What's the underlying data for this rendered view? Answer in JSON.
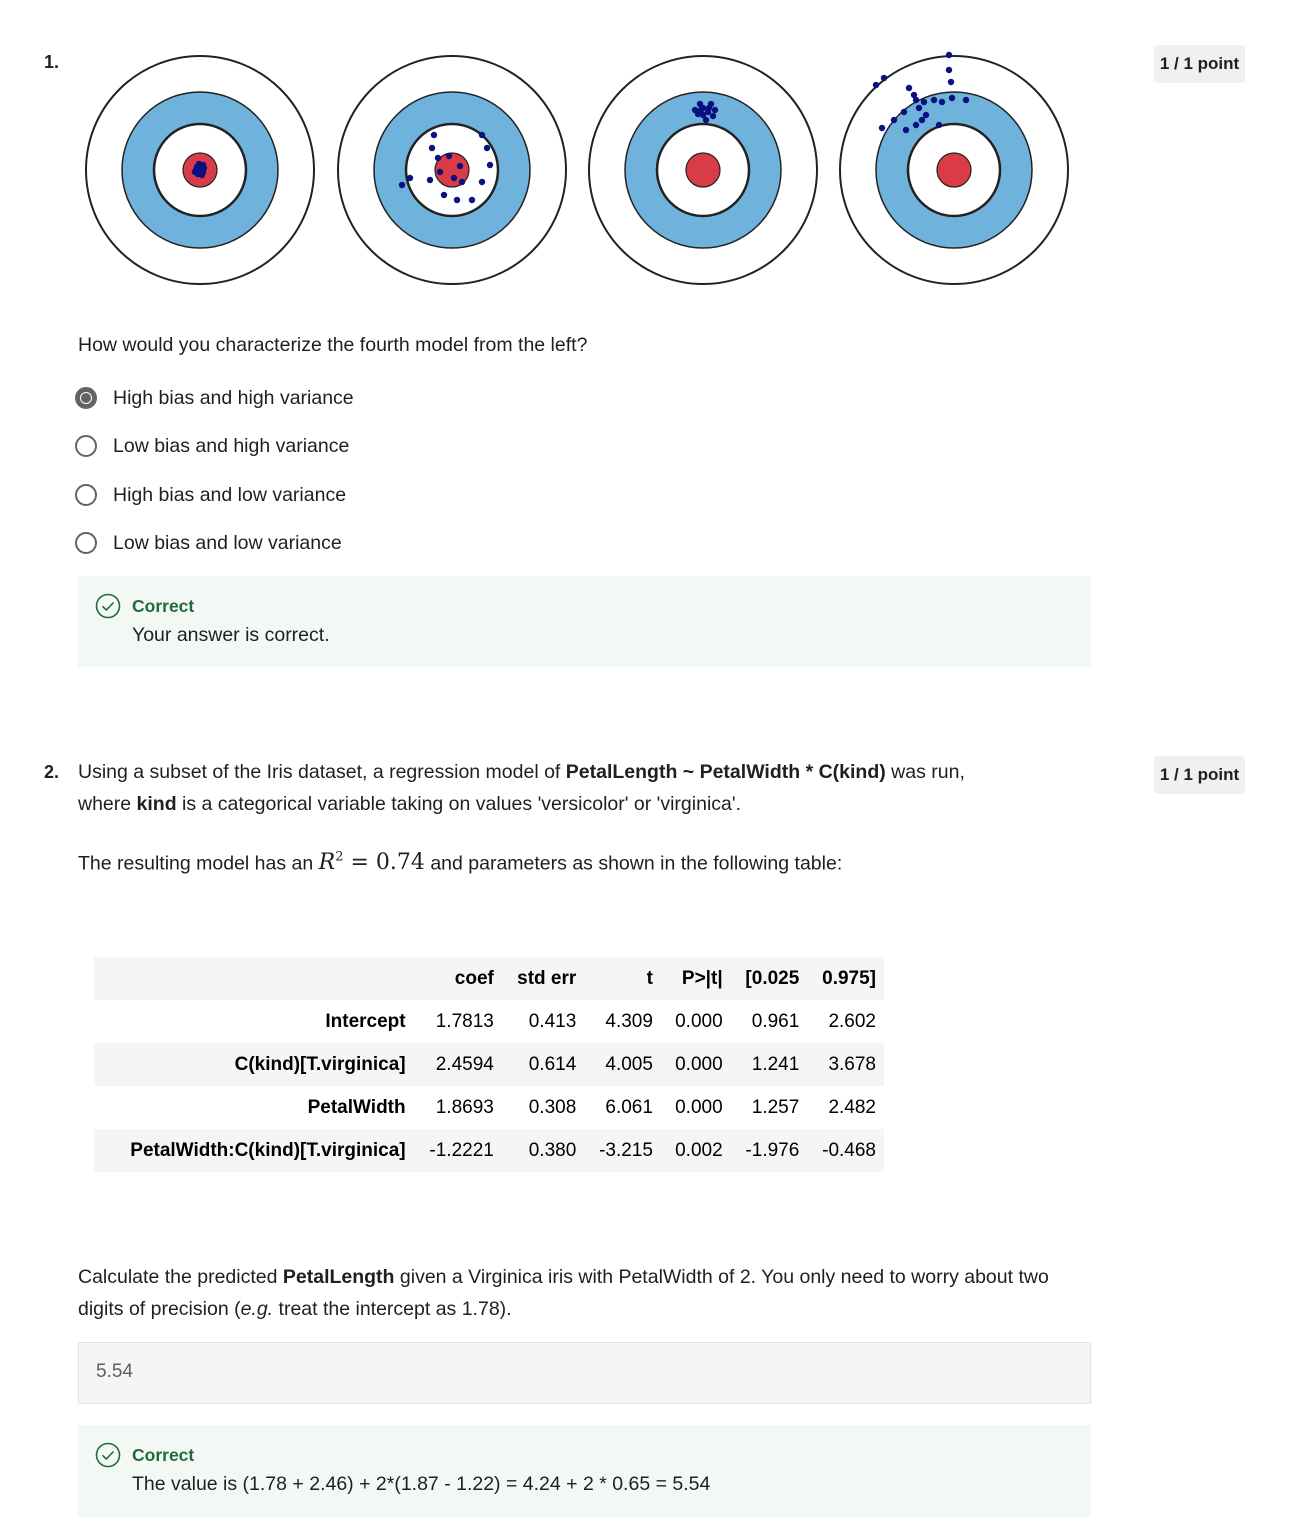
{
  "q1": {
    "number": "1.",
    "points": "1 / 1 point",
    "question": "How would you characterize the fourth model from the left?",
    "options": [
      "High bias and high variance",
      "Low bias and high variance",
      "High bias and low variance",
      "Low bias and low variance"
    ],
    "selected_index": 0,
    "feedback_title": "Correct",
    "feedback_text": "Your answer is correct.",
    "colors": {
      "outer_ring": "#ffffff",
      "blue_ring": "#6fb2dc",
      "bullseye": "#d93c46",
      "dots": "#0b1080"
    }
  },
  "q2": {
    "number": "2.",
    "points": "1 / 1 point",
    "intro_pre": "Using a subset of the Iris dataset, a regression model of ",
    "intro_bold1": "PetalLength ~ PetalWidth * C(kind)",
    "intro_mid": " was run,",
    "line2_pre": "where ",
    "line2_bold": "kind",
    "line2_post": " is a categorical variable taking on values 'versicolor' or 'virginica'.",
    "r2_pre": "The resulting model has an ",
    "r2_symbol": "R",
    "r2_sup": "2",
    "r2_eq": " = 0.74",
    "r2_post": " and parameters as shown in the following table:",
    "table": {
      "headers": [
        "coef",
        "std err",
        "t",
        "P>|t|",
        "[0.025",
        "0.975]"
      ],
      "rows": [
        {
          "label": "Intercept",
          "cells": [
            "1.7813",
            "0.413",
            "4.309",
            "0.000",
            "0.961",
            "2.602"
          ]
        },
        {
          "label": "C(kind)[T.virginica]",
          "cells": [
            "2.4594",
            "0.614",
            "4.005",
            "0.000",
            "1.241",
            "3.678"
          ]
        },
        {
          "label": "PetalWidth",
          "cells": [
            "1.8693",
            "0.308",
            "6.061",
            "0.000",
            "1.257",
            "2.482"
          ]
        },
        {
          "label": "PetalWidth:C(kind)[T.virginica]",
          "cells": [
            "-1.2221",
            "0.380",
            "-3.215",
            "0.002",
            "-1.976",
            "-0.468"
          ]
        }
      ]
    },
    "calc_pre": "Calculate the predicted ",
    "calc_bold": "PetalLength",
    "calc_post": " given a Virginica iris with PetalWidth of 2. You only need to worry about two",
    "calc_line2_pre": "digits of precision (",
    "calc_line2_italic": "e.g.",
    "calc_line2_post": " treat the intercept as 1.78).",
    "answer_value": "5.54",
    "feedback_title": "Correct",
    "feedback_text": "The value is (1.78 + 2.46) + 2*(1.87 - 1.22) = 4.24 + 2 * 0.65 = 5.54"
  }
}
